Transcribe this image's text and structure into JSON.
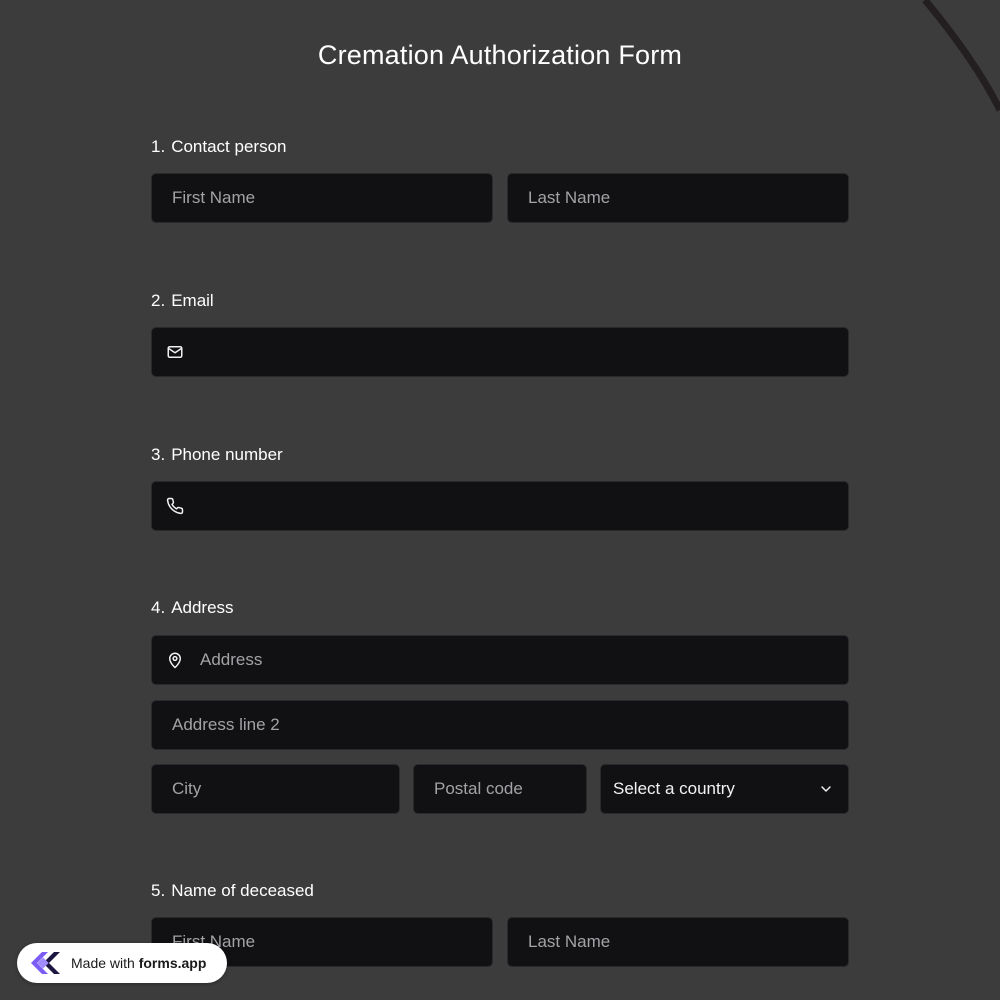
{
  "form": {
    "title": "Cremation Authorization Form"
  },
  "questions": {
    "q1": {
      "num": "1.",
      "label": "Contact person",
      "first_placeholder": "First Name",
      "last_placeholder": "Last Name"
    },
    "q2": {
      "num": "2.",
      "label": "Email",
      "icon": "mail-icon"
    },
    "q3": {
      "num": "3.",
      "label": "Phone number",
      "icon": "phone-icon"
    },
    "q4": {
      "num": "4.",
      "label": "Address",
      "address_placeholder": "Address",
      "address2_placeholder": "Address line 2",
      "city_placeholder": "City",
      "postal_placeholder": "Postal code",
      "country_selected": "Select a country",
      "icon": "map-pin-icon"
    },
    "q5": {
      "num": "5.",
      "label": "Name of deceased",
      "first_placeholder": "First Name",
      "last_placeholder": "Last Name"
    }
  },
  "badge": {
    "prefix": "Made with",
    "brand": "forms.app"
  },
  "colors": {
    "background": "#3d3c3d",
    "field": "#111113",
    "brand": "#7b5cf5"
  }
}
